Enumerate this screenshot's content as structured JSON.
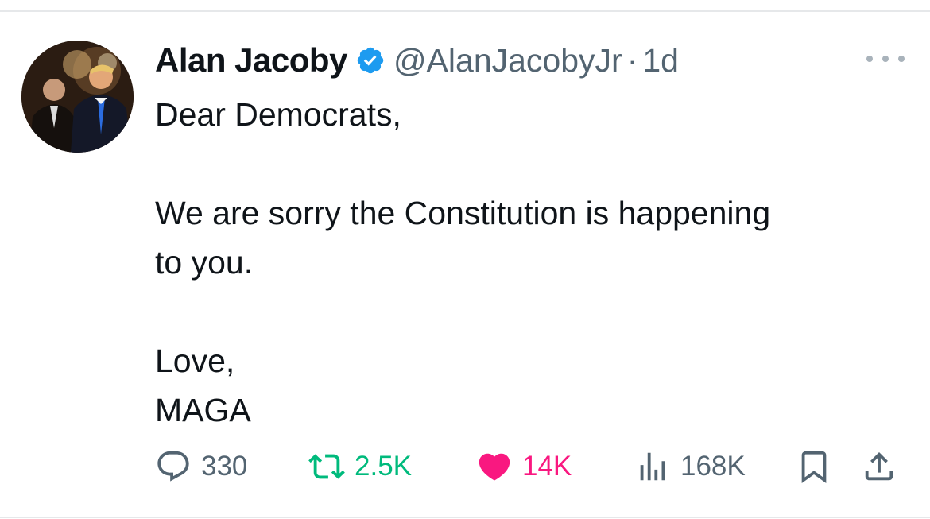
{
  "tweet": {
    "author": {
      "display_name": "Alan Jacoby",
      "verified": true,
      "handle": "@AlanJacobyJr",
      "separator": "·",
      "time": "1d"
    },
    "text_lines": [
      "Dear Democrats,",
      "",
      "We are sorry the Constitution is happening",
      "to you.",
      "",
      "Love,",
      "MAGA"
    ],
    "actions": {
      "replies": "330",
      "reposts": "2.5K",
      "likes": "14K",
      "views": "168K"
    }
  },
  "icons": {
    "verified": "verified-badge-icon",
    "more": "more-options-icon",
    "reply": "reply-icon",
    "repost": "repost-icon",
    "like": "heart-icon",
    "views": "views-icon",
    "bookmark": "bookmark-icon",
    "share": "share-icon"
  },
  "colors": {
    "verified_blue": "#1d9bf0",
    "repost_green": "#00ba7c",
    "like_pink": "#f91880",
    "secondary_text": "#536471",
    "primary_text": "#0f1419"
  }
}
